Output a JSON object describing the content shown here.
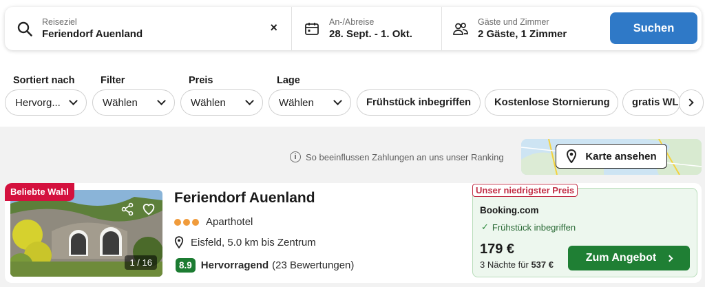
{
  "search": {
    "destination_label": "Reiseziel",
    "destination_value": "Feriendorf Auenland",
    "clear_symbol": "×",
    "dates_label": "An-/Abreise",
    "dates_value": "28. Sept. - 1. Okt.",
    "guests_label": "Gäste und Zimmer",
    "guests_value": "2 Gäste, 1 Zimmer",
    "search_button": "Suchen"
  },
  "filters": {
    "sort": {
      "label": "Sortiert nach",
      "value": "Hervorg..."
    },
    "filter": {
      "label": "Filter",
      "value": "Wählen"
    },
    "price": {
      "label": "Preis",
      "value": "Wählen"
    },
    "location": {
      "label": "Lage",
      "value": "Wählen"
    },
    "chips": [
      "Frühstück inbegriffen",
      "Kostenlose Stornierung",
      "gratis WLAN"
    ]
  },
  "ranking_notice": "So beeinflussen Zahlungen an uns unser Ranking",
  "map_button": "Karte ansehen",
  "listing": {
    "badge": "Beliebte Wahl",
    "photo_counter": "1 / 16",
    "name": "Feriendorf Auenland",
    "property_type": "Aparthotel",
    "location": "Eisfeld, 5.0 km bis Zentrum",
    "score": "8.9",
    "rating_word": "Hervorragend",
    "reviews": "(23 Bewertungen)",
    "offer": {
      "badge": "Unser niedrigster Preis",
      "provider": "Booking.com",
      "feature": "Frühstück inbegriffen",
      "price": "179 €",
      "nights_text": "3 Nächte für",
      "total": "537 €",
      "cta": "Zum Angebot"
    }
  },
  "colors": {
    "primary_blue": "#2f79c7",
    "deal_green": "#1f7f34",
    "badge_red": "#d4113e",
    "star_orange": "#f09b3b"
  }
}
